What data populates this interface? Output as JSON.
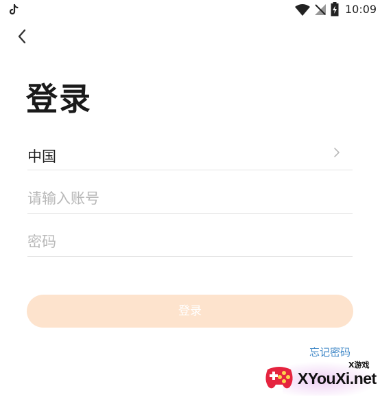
{
  "status_bar": {
    "time": "10:09",
    "icons": [
      "tiktok-icon",
      "wifi-icon",
      "signal-off-icon",
      "battery-charging-icon"
    ]
  },
  "nav": {
    "back_icon": "chevron-left-icon"
  },
  "title": "登录",
  "form": {
    "country": {
      "value": "中国",
      "icon": "chevron-right-icon"
    },
    "account": {
      "value": "",
      "placeholder": "请输入账号"
    },
    "password": {
      "value": "",
      "placeholder": "密码"
    }
  },
  "login_button": {
    "label": "登录",
    "color": "#fde3cd"
  },
  "forgot_password": {
    "label": "忘记密码",
    "color": "#3d86c6"
  },
  "watermark": {
    "small": "X游戏",
    "big": "XYouXi.net"
  }
}
